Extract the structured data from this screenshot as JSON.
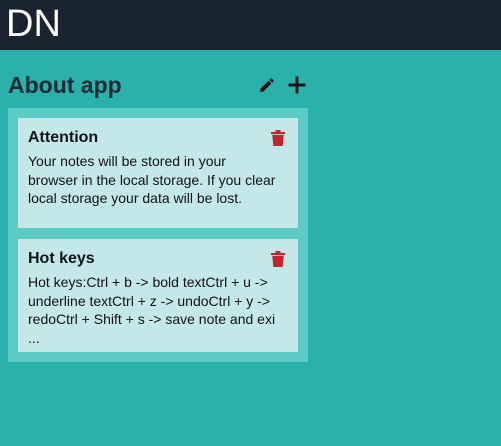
{
  "app": {
    "logo": "DN"
  },
  "section": {
    "title": "About app",
    "edit_icon": "pencil-icon",
    "add_icon": "plus-icon"
  },
  "notes": [
    {
      "title": "Attention",
      "body": "Your notes will be stored in your browser in the local storage. If you clear local storage your data will be lost.",
      "delete_icon": "trash-icon"
    },
    {
      "title": "Hot keys",
      "body": "Hot keys:Ctrl + b -> bold textCtrl + u -> underline textCtrl + z -> undoCtrl + y -> redoCtrl + Shift + s -> save note and exi ...",
      "delete_icon": "trash-icon"
    }
  ],
  "colors": {
    "background": "#2bb1ac",
    "topbar": "#1a2330",
    "panel": "#5ccac5",
    "card": "#c4e8e7",
    "delete": "#c0272d"
  }
}
